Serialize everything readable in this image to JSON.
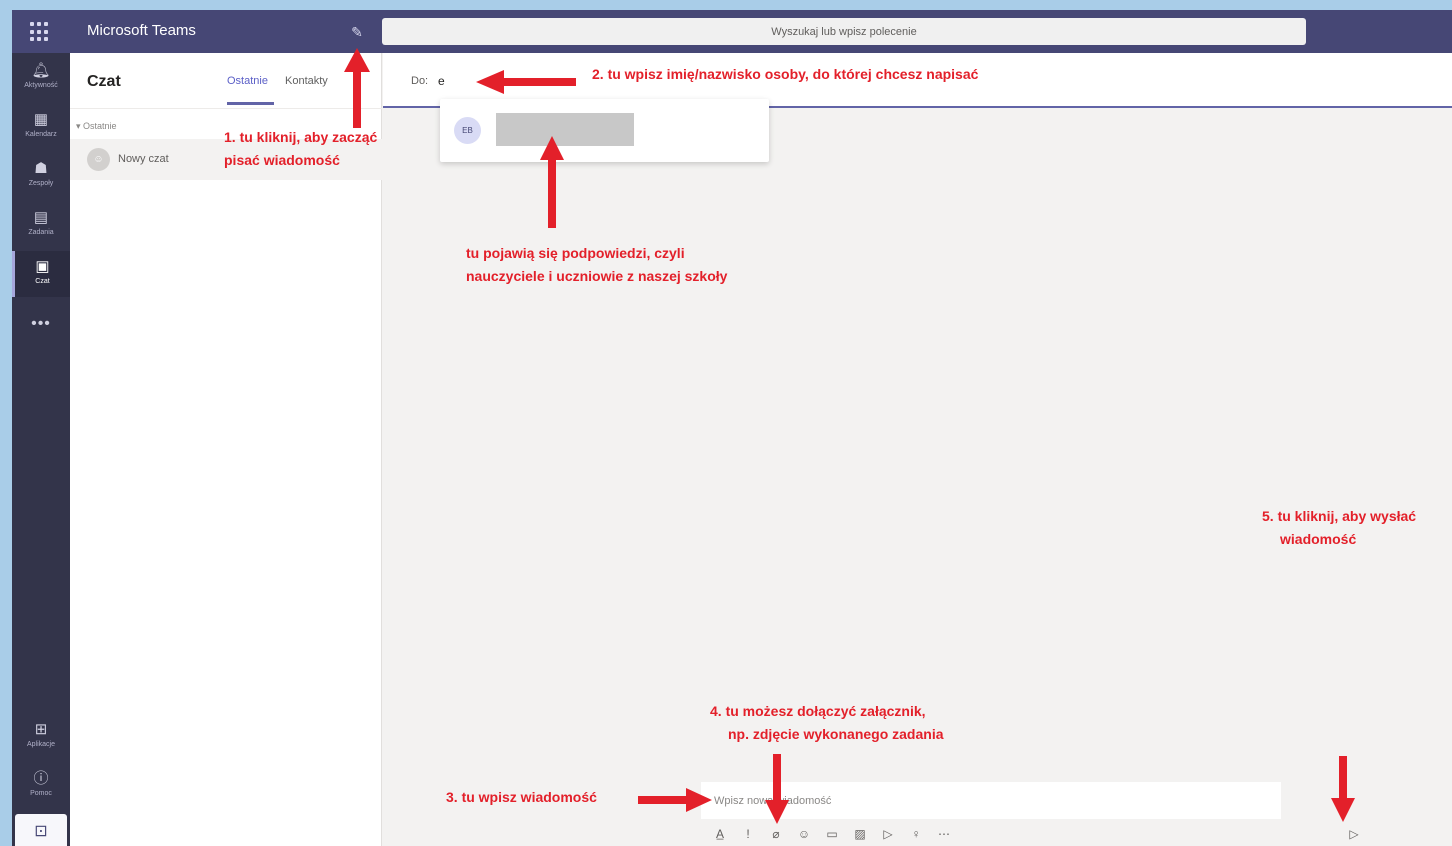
{
  "app": {
    "title": "Microsoft Teams",
    "search_placeholder": "Wyszukaj lub wpisz polecenie"
  },
  "rail": {
    "items": [
      {
        "label": "Aktywność",
        "icon": "bell-icon"
      },
      {
        "label": "Kalendarz",
        "icon": "calendar-icon"
      },
      {
        "label": "Zespoły",
        "icon": "teams-icon"
      },
      {
        "label": "Zadania",
        "icon": "assignments-icon"
      },
      {
        "label": "Czat",
        "icon": "chat-icon"
      }
    ],
    "more": "•••",
    "bottom_items": [
      {
        "label": "Aplikacje",
        "icon": "apps-icon"
      },
      {
        "label": "Pomoc",
        "icon": "help-icon"
      }
    ]
  },
  "chat_list": {
    "title": "Czat",
    "tabs": [
      "Ostatnie",
      "Kontakty"
    ],
    "section_label": "Ostatnie",
    "items": [
      {
        "label": "Nowy czat"
      }
    ]
  },
  "new_chat": {
    "to_label": "Do:",
    "to_value": "e",
    "suggestion_initials": "EB"
  },
  "composer": {
    "placeholder": "Wpisz nową wiadomość"
  },
  "annotations": {
    "step1": [
      "1. tu kliknij, aby zacząć",
      "pisać wiadomość"
    ],
    "step2": "2. tu wpisz imię/nazwisko osoby, do której chcesz napisać",
    "suggestions": [
      "tu pojawią się podpowiedzi, czyli",
      "nauczyciele i uczniowie z naszej szkoły"
    ],
    "step3": "3. tu wpisz wiadomość",
    "step4": [
      "4. tu możesz dołączyć załącznik,",
      "np. zdjęcie wykonanego zadania"
    ],
    "step5": [
      "5. tu kliknij, aby wysłać",
      "wiadomość"
    ],
    "color": "#e3202a"
  },
  "colors": {
    "topbar": "#464775",
    "rail": "#33344a",
    "accent": "#6264a7"
  }
}
